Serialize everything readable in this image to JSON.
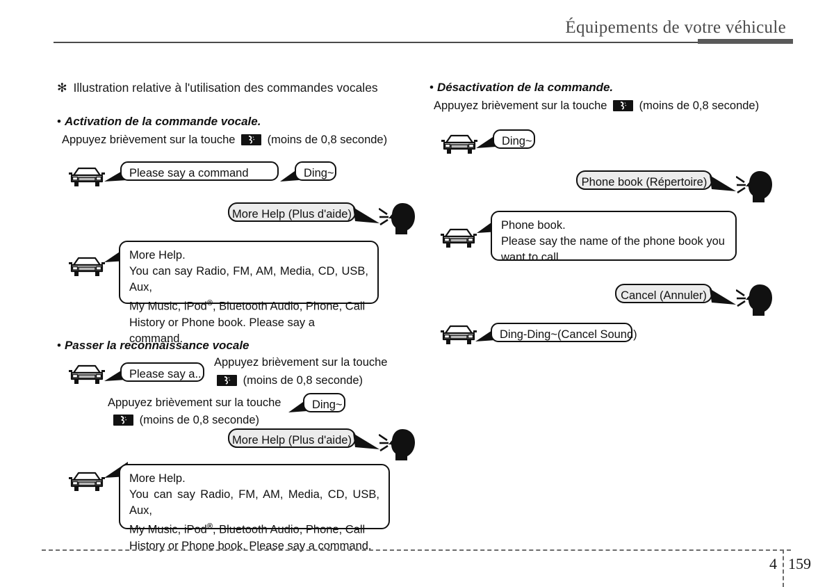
{
  "header": {
    "title": "Équipements de votre véhicule"
  },
  "footer": {
    "chapter": "4",
    "page": "159"
  },
  "note": {
    "symbol": "✻",
    "text": "Illustration relative à l'utilisation des commandes vocales"
  },
  "common": {
    "bullet": "•",
    "press_prefix": "Appuyez brièvement sur la touche",
    "press_suffix": "(moins de 0,8 seconde)",
    "key_icon": "voice-command-key-icon",
    "car_icon": "car-front-icon",
    "head_icon": "speaking-head-icon"
  },
  "left_column": {
    "section1": {
      "heading": "Activation de la commande vocale.",
      "instruction_prefix": "Appuyez brièvement sur la touche",
      "instruction_suffix": "(moins de 0,8 seconde)",
      "bubbles": {
        "say_command": "Please say a command",
        "ding": "Ding~",
        "more_help_user": "More Help (Plus d'aide)",
        "more_help_title": "More Help.",
        "more_help_l1": "You can say Radio, FM, AM, Media, CD, USB, Aux,",
        "more_help_l2_a": "My Music, iPod",
        "more_help_l2_reg": "®",
        "more_help_l2_b": ", Bluetooth Audio, Phone, Call",
        "more_help_l3": "History or Phone book. Please say a command."
      }
    },
    "section2": {
      "heading": "Passer la reconnaissance vocale",
      "bubbles": {
        "say_a": "Please say a...",
        "ding": "Ding~",
        "more_help_user": "More Help (Plus d'aide)",
        "more_help_title": "More Help.",
        "more_help_l1": "You can say Radio, FM, AM, Media, CD, USB, Aux,",
        "more_help_l2_a": "My Music, iPod",
        "more_help_l2_reg": "®",
        "more_help_l2_b": ", Bluetooth Audio, Phone, Call",
        "more_help_l3": "History or Phone book. Please say a command."
      },
      "instruction1_prefix": "Appuyez brièvement sur la touche",
      "instruction1_suffix": "(moins de 0,8 seconde)",
      "instruction2_prefix": "Appuyez brièvement sur la touche",
      "instruction2_suffix": "(moins de 0,8 seconde)"
    }
  },
  "right_column": {
    "section1": {
      "heading": "Désactivation de la commande.",
      "instruction_prefix": "Appuyez brièvement sur la touche",
      "instruction_suffix": "(moins de 0,8 seconde)",
      "bubbles": {
        "ding": "Ding~",
        "phone_book_user": "Phone book (Répertoire)",
        "phone_book_title": "Phone book.",
        "phone_book_l1": "Please say the name of the phone book you",
        "phone_book_l2": "want to call.",
        "cancel_user": "Cancel (Annuler)",
        "ding_ding": "Ding-Ding~(Cancel Sound)"
      }
    }
  },
  "colors": {
    "header_text": "#4a4a4a",
    "header_bar": "#595959",
    "body_text": "#111111",
    "bubble_user_fill": "#ececec",
    "bubble_car_fill": "#ffffff",
    "key_badge": "#121212"
  }
}
